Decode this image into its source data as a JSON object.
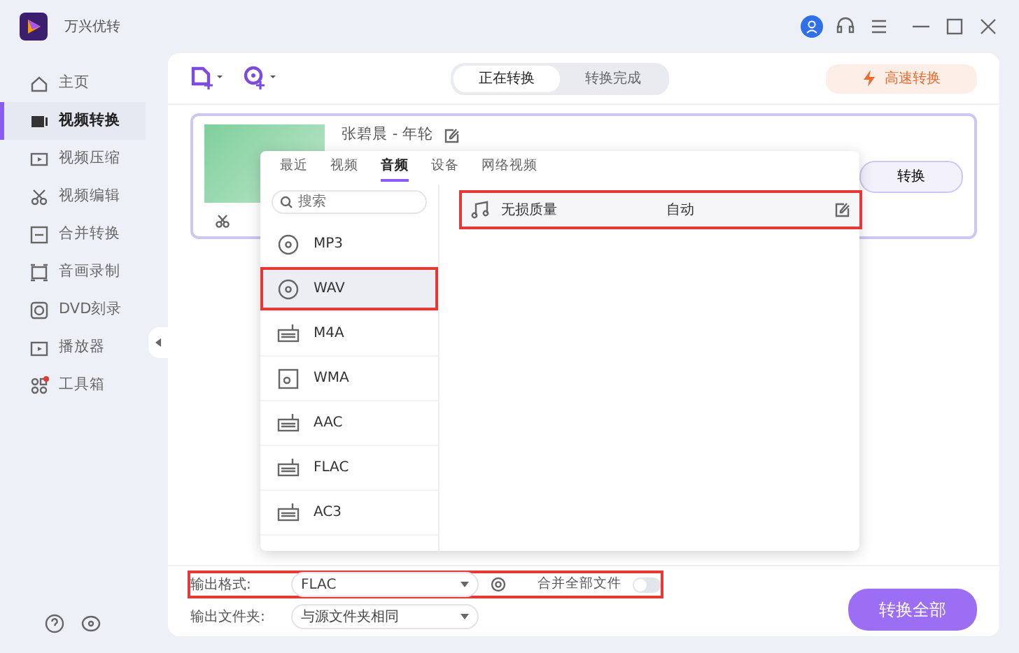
{
  "app": {
    "title": "万兴优转"
  },
  "sidebar": {
    "items": [
      {
        "kind": "home",
        "label": "主页",
        "selected": false,
        "badge": false
      },
      {
        "kind": "convert",
        "label": "视频转换",
        "selected": true,
        "badge": false
      },
      {
        "kind": "compress",
        "label": "视频压缩",
        "selected": false,
        "badge": false
      },
      {
        "kind": "edit",
        "label": "视频编辑",
        "selected": false,
        "badge": false
      },
      {
        "kind": "merge",
        "label": "合并转换",
        "selected": false,
        "badge": false
      },
      {
        "kind": "record",
        "label": "音画录制",
        "selected": false,
        "badge": false
      },
      {
        "kind": "dvd",
        "label": "DVD刻录",
        "selected": false,
        "badge": false
      },
      {
        "kind": "player",
        "label": "播放器",
        "selected": false,
        "badge": false
      },
      {
        "kind": "toolbox",
        "label": "工具箱",
        "selected": false,
        "badge": true
      }
    ]
  },
  "toolbar": {
    "tabs": [
      {
        "label": "正在转换",
        "selected": true
      },
      {
        "label": "转换完成",
        "selected": false
      }
    ],
    "speed_button": "高速转换"
  },
  "file": {
    "title": "张碧晨 - 年轮",
    "convert_button": "转换"
  },
  "format_popup": {
    "tabs": [
      {
        "label": "最近",
        "selected": false
      },
      {
        "label": "视频",
        "selected": false
      },
      {
        "label": "音频",
        "selected": true
      },
      {
        "label": "设备",
        "selected": false
      },
      {
        "label": "网络视频",
        "selected": false
      }
    ],
    "search": {
      "placeholder": "搜索"
    },
    "formats": [
      {
        "kind": "disc",
        "label": "MP3",
        "selected": false,
        "highlighted": false
      },
      {
        "kind": "disc",
        "label": "WAV",
        "selected": true,
        "highlighted": true
      },
      {
        "kind": "device",
        "label": "M4A",
        "selected": false,
        "highlighted": false
      },
      {
        "kind": "square",
        "label": "WMA",
        "selected": false,
        "highlighted": false
      },
      {
        "kind": "device",
        "label": "AAC",
        "selected": false,
        "highlighted": false
      },
      {
        "kind": "device",
        "label": "FLAC",
        "selected": false,
        "highlighted": false
      },
      {
        "kind": "device",
        "label": "AC3",
        "selected": false,
        "highlighted": false
      }
    ],
    "presets": [
      {
        "name": "无损质量",
        "value": "自动",
        "highlighted": true
      }
    ]
  },
  "bottom": {
    "output_format": {
      "label": "输出格式:",
      "value": "FLAC",
      "highlighted": true
    },
    "merge": {
      "label": "合并全部文件",
      "on": false
    },
    "output_folder": {
      "label": "输出文件夹:",
      "value": "与源文件夹相同"
    },
    "convert_all": "转换全部"
  }
}
